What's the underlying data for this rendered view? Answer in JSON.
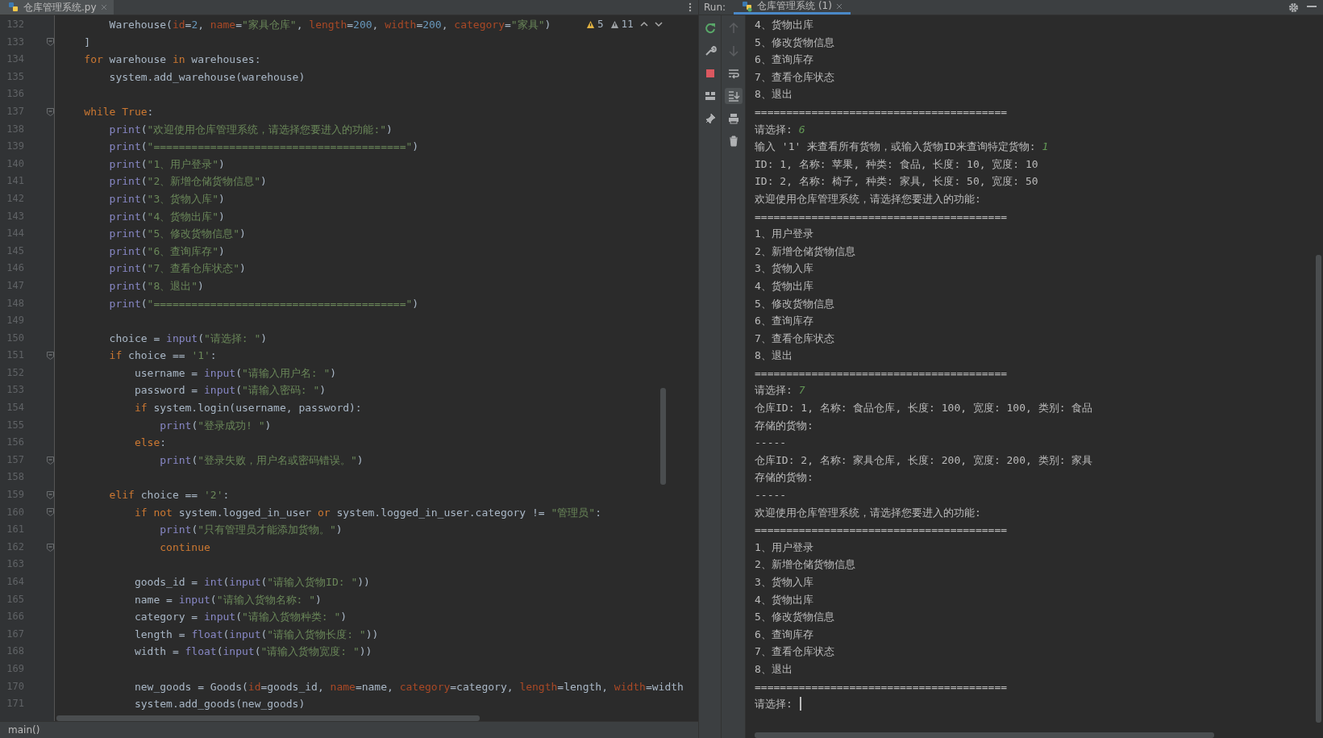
{
  "editor": {
    "tabs": [
      {
        "label": "仓库管理系统.py",
        "selected": true
      }
    ],
    "inspections": [
      {
        "kind": "warning",
        "count": "5"
      },
      {
        "kind": "weak-warning",
        "count": "11"
      }
    ],
    "lines": [
      {
        "number": "132",
        "fold": false,
        "tokens": [
          {
            "kind": "plain",
            "text": "        Warehouse("
          },
          {
            "kind": "param",
            "text": "id"
          },
          {
            "kind": "plain",
            "text": "="
          },
          {
            "kind": "num",
            "text": "2"
          },
          {
            "kind": "plain",
            "text": ", "
          },
          {
            "kind": "param",
            "text": "name"
          },
          {
            "kind": "plain",
            "text": "="
          },
          {
            "kind": "str",
            "text": "\"家具仓库\""
          },
          {
            "kind": "plain",
            "text": ", "
          },
          {
            "kind": "param",
            "text": "length"
          },
          {
            "kind": "plain",
            "text": "="
          },
          {
            "kind": "num",
            "text": "200"
          },
          {
            "kind": "plain",
            "text": ", "
          },
          {
            "kind": "param",
            "text": "width"
          },
          {
            "kind": "plain",
            "text": "="
          },
          {
            "kind": "num",
            "text": "200"
          },
          {
            "kind": "plain",
            "text": ", "
          },
          {
            "kind": "param",
            "text": "category"
          },
          {
            "kind": "plain",
            "text": "="
          },
          {
            "kind": "str",
            "text": "\"家具\""
          },
          {
            "kind": "plain",
            "text": ")"
          }
        ]
      },
      {
        "number": "133",
        "fold": true,
        "tokens": [
          {
            "kind": "plain",
            "text": "    ]"
          }
        ]
      },
      {
        "number": "134",
        "fold": false,
        "tokens": [
          {
            "kind": "kw",
            "text": "    for"
          },
          {
            "kind": "plain",
            "text": " warehouse "
          },
          {
            "kind": "kw",
            "text": "in"
          },
          {
            "kind": "plain",
            "text": " warehouses:"
          }
        ]
      },
      {
        "number": "135",
        "fold": false,
        "tokens": [
          {
            "kind": "plain",
            "text": "        system.add_warehouse(warehouse)"
          }
        ]
      },
      {
        "number": "136",
        "fold": false
      },
      {
        "number": "137",
        "fold": true,
        "tokens": [
          {
            "kind": "kw",
            "text": "    while"
          },
          {
            "kind": "kw",
            "text": " True"
          },
          {
            "kind": "plain",
            "text": ":"
          }
        ]
      },
      {
        "number": "138",
        "fold": false,
        "tokens": [
          {
            "kind": "fn",
            "text": "        print"
          },
          {
            "kind": "plain",
            "text": "("
          },
          {
            "kind": "str",
            "text": "\"欢迎使用仓库管理系统，请选择您要进入的功能:\""
          },
          {
            "kind": "plain",
            "text": ")"
          }
        ]
      },
      {
        "number": "139",
        "fold": false,
        "tokens": [
          {
            "kind": "fn",
            "text": "        print"
          },
          {
            "kind": "plain",
            "text": "("
          },
          {
            "kind": "str",
            "text": "\"========================================\""
          },
          {
            "kind": "plain",
            "text": ")"
          }
        ]
      },
      {
        "number": "140",
        "fold": false,
        "tokens": [
          {
            "kind": "fn",
            "text": "        print"
          },
          {
            "kind": "plain",
            "text": "("
          },
          {
            "kind": "str",
            "text": "\"1、用户登录\""
          },
          {
            "kind": "plain",
            "text": ")"
          }
        ]
      },
      {
        "number": "141",
        "fold": false,
        "tokens": [
          {
            "kind": "fn",
            "text": "        print"
          },
          {
            "kind": "plain",
            "text": "("
          },
          {
            "kind": "str",
            "text": "\"2、新增仓储货物信息\""
          },
          {
            "kind": "plain",
            "text": ")"
          }
        ]
      },
      {
        "number": "142",
        "fold": false,
        "tokens": [
          {
            "kind": "fn",
            "text": "        print"
          },
          {
            "kind": "plain",
            "text": "("
          },
          {
            "kind": "str",
            "text": "\"3、货物入库\""
          },
          {
            "kind": "plain",
            "text": ")"
          }
        ]
      },
      {
        "number": "143",
        "fold": false,
        "tokens": [
          {
            "kind": "fn",
            "text": "        print"
          },
          {
            "kind": "plain",
            "text": "("
          },
          {
            "kind": "str",
            "text": "\"4、货物出库\""
          },
          {
            "kind": "plain",
            "text": ")"
          }
        ]
      },
      {
        "number": "144",
        "fold": false,
        "tokens": [
          {
            "kind": "fn",
            "text": "        print"
          },
          {
            "kind": "plain",
            "text": "("
          },
          {
            "kind": "str",
            "text": "\"5、修改货物信息\""
          },
          {
            "kind": "plain",
            "text": ")"
          }
        ]
      },
      {
        "number": "145",
        "fold": false,
        "tokens": [
          {
            "kind": "fn",
            "text": "        print"
          },
          {
            "kind": "plain",
            "text": "("
          },
          {
            "kind": "str",
            "text": "\"6、查询库存\""
          },
          {
            "kind": "plain",
            "text": ")"
          }
        ]
      },
      {
        "number": "146",
        "fold": false,
        "tokens": [
          {
            "kind": "fn",
            "text": "        print"
          },
          {
            "kind": "plain",
            "text": "("
          },
          {
            "kind": "str",
            "text": "\"7、查看仓库状态\""
          },
          {
            "kind": "plain",
            "text": ")"
          }
        ]
      },
      {
        "number": "147",
        "fold": false,
        "tokens": [
          {
            "kind": "fn",
            "text": "        print"
          },
          {
            "kind": "plain",
            "text": "("
          },
          {
            "kind": "str",
            "text": "\"8、退出\""
          },
          {
            "kind": "plain",
            "text": ")"
          }
        ]
      },
      {
        "number": "148",
        "fold": false,
        "tokens": [
          {
            "kind": "fn",
            "text": "        print"
          },
          {
            "kind": "plain",
            "text": "("
          },
          {
            "kind": "str",
            "text": "\"========================================\""
          },
          {
            "kind": "plain",
            "text": ")"
          }
        ]
      },
      {
        "number": "149",
        "fold": false
      },
      {
        "number": "150",
        "fold": false,
        "tokens": [
          {
            "kind": "plain",
            "text": "        choice = "
          },
          {
            "kind": "fn",
            "text": "input"
          },
          {
            "kind": "plain",
            "text": "("
          },
          {
            "kind": "str",
            "text": "\"请选择: \""
          },
          {
            "kind": "plain",
            "text": ")"
          }
        ]
      },
      {
        "number": "151",
        "fold": true,
        "tokens": [
          {
            "kind": "kw",
            "text": "        if"
          },
          {
            "kind": "plain",
            "text": " choice == "
          },
          {
            "kind": "str",
            "text": "'1'"
          },
          {
            "kind": "plain",
            "text": ":"
          }
        ]
      },
      {
        "number": "152",
        "fold": false,
        "tokens": [
          {
            "kind": "plain",
            "text": "            username = "
          },
          {
            "kind": "fn",
            "text": "input"
          },
          {
            "kind": "plain",
            "text": "("
          },
          {
            "kind": "str",
            "text": "\"请输入用户名: \""
          },
          {
            "kind": "plain",
            "text": ")"
          }
        ]
      },
      {
        "number": "153",
        "fold": false,
        "tokens": [
          {
            "kind": "plain",
            "text": "            password = "
          },
          {
            "kind": "fn",
            "text": "input"
          },
          {
            "kind": "plain",
            "text": "("
          },
          {
            "kind": "str",
            "text": "\"请输入密码: \""
          },
          {
            "kind": "plain",
            "text": ")"
          }
        ]
      },
      {
        "number": "154",
        "fold": false,
        "tokens": [
          {
            "kind": "kw",
            "text": "            if"
          },
          {
            "kind": "plain",
            "text": " system.login(username, password):"
          }
        ]
      },
      {
        "number": "155",
        "fold": false,
        "tokens": [
          {
            "kind": "fn",
            "text": "                print"
          },
          {
            "kind": "plain",
            "text": "("
          },
          {
            "kind": "str",
            "text": "\"登录成功! \""
          },
          {
            "kind": "plain",
            "text": ")"
          }
        ]
      },
      {
        "number": "156",
        "fold": false,
        "tokens": [
          {
            "kind": "kw",
            "text": "            else"
          },
          {
            "kind": "plain",
            "text": ":"
          }
        ]
      },
      {
        "number": "157",
        "fold": true,
        "tokens": [
          {
            "kind": "fn",
            "text": "                print"
          },
          {
            "kind": "plain",
            "text": "("
          },
          {
            "kind": "str",
            "text": "\"登录失败，用户名或密码错误。\""
          },
          {
            "kind": "plain",
            "text": ")"
          }
        ]
      },
      {
        "number": "158",
        "fold": false
      },
      {
        "number": "159",
        "fold": true,
        "tokens": [
          {
            "kind": "kw",
            "text": "        elif"
          },
          {
            "kind": "plain",
            "text": " choice == "
          },
          {
            "kind": "str",
            "text": "'2'"
          },
          {
            "kind": "plain",
            "text": ":"
          }
        ]
      },
      {
        "number": "160",
        "fold": true,
        "tokens": [
          {
            "kind": "kw",
            "text": "            if"
          },
          {
            "kind": "kw",
            "text": " not"
          },
          {
            "kind": "plain",
            "text": " system.logged_in_user "
          },
          {
            "kind": "kw",
            "text": "or"
          },
          {
            "kind": "plain",
            "text": " system.logged_in_user.category != "
          },
          {
            "kind": "str",
            "text": "\"管理员\""
          },
          {
            "kind": "plain",
            "text": ":"
          }
        ]
      },
      {
        "number": "161",
        "fold": false,
        "tokens": [
          {
            "kind": "fn",
            "text": "                print"
          },
          {
            "kind": "plain",
            "text": "("
          },
          {
            "kind": "str",
            "text": "\"只有管理员才能添加货物。\""
          },
          {
            "kind": "plain",
            "text": ")"
          }
        ]
      },
      {
        "number": "162",
        "fold": true,
        "tokens": [
          {
            "kind": "kw",
            "text": "                continue"
          }
        ]
      },
      {
        "number": "163",
        "fold": false
      },
      {
        "number": "164",
        "fold": false,
        "tokens": [
          {
            "kind": "plain",
            "text": "            goods_id = "
          },
          {
            "kind": "fn",
            "text": "int"
          },
          {
            "kind": "plain",
            "text": "("
          },
          {
            "kind": "fn",
            "text": "input"
          },
          {
            "kind": "plain",
            "text": "("
          },
          {
            "kind": "str",
            "text": "\"请输入货物ID: \""
          },
          {
            "kind": "plain",
            "text": "))"
          }
        ]
      },
      {
        "number": "165",
        "fold": false,
        "tokens": [
          {
            "kind": "plain",
            "text": "            name = "
          },
          {
            "kind": "fn",
            "text": "input"
          },
          {
            "kind": "plain",
            "text": "("
          },
          {
            "kind": "str",
            "text": "\"请输入货物名称: \""
          },
          {
            "kind": "plain",
            "text": ")"
          }
        ]
      },
      {
        "number": "166",
        "fold": false,
        "tokens": [
          {
            "kind": "plain",
            "text": "            category = "
          },
          {
            "kind": "fn",
            "text": "input"
          },
          {
            "kind": "plain",
            "text": "("
          },
          {
            "kind": "str",
            "text": "\"请输入货物种类: \""
          },
          {
            "kind": "plain",
            "text": ")"
          }
        ]
      },
      {
        "number": "167",
        "fold": false,
        "tokens": [
          {
            "kind": "plain",
            "text": "            length = "
          },
          {
            "kind": "fn",
            "text": "float"
          },
          {
            "kind": "plain",
            "text": "("
          },
          {
            "kind": "fn",
            "text": "input"
          },
          {
            "kind": "plain",
            "text": "("
          },
          {
            "kind": "str",
            "text": "\"请输入货物长度: \""
          },
          {
            "kind": "plain",
            "text": "))"
          }
        ]
      },
      {
        "number": "168",
        "fold": false,
        "tokens": [
          {
            "kind": "plain",
            "text": "            width = "
          },
          {
            "kind": "fn",
            "text": "float"
          },
          {
            "kind": "plain",
            "text": "("
          },
          {
            "kind": "fn",
            "text": "input"
          },
          {
            "kind": "plain",
            "text": "("
          },
          {
            "kind": "str",
            "text": "\"请输入货物宽度: \""
          },
          {
            "kind": "plain",
            "text": "))"
          }
        ]
      },
      {
        "number": "169",
        "fold": false
      },
      {
        "number": "170",
        "fold": false,
        "tokens": [
          {
            "kind": "plain",
            "text": "            new_goods = Goods("
          },
          {
            "kind": "param",
            "text": "id"
          },
          {
            "kind": "plain",
            "text": "=goods_id, "
          },
          {
            "kind": "param",
            "text": "name"
          },
          {
            "kind": "plain",
            "text": "=name, "
          },
          {
            "kind": "param",
            "text": "category"
          },
          {
            "kind": "plain",
            "text": "=category, "
          },
          {
            "kind": "param",
            "text": "length"
          },
          {
            "kind": "plain",
            "text": "=length, "
          },
          {
            "kind": "param",
            "text": "width"
          },
          {
            "kind": "plain",
            "text": "=width"
          }
        ]
      },
      {
        "number": "171",
        "fold": false,
        "tokens": [
          {
            "kind": "plain",
            "text": "            system.add_goods(new_goods)"
          }
        ]
      }
    ],
    "breadcrumb": "main()"
  },
  "run": {
    "label": "Run:",
    "tabs": [
      {
        "label": "仓库管理系统 (1)",
        "selected": true
      }
    ],
    "actions": [
      {
        "kind": "rerun"
      },
      {
        "kind": "wrench"
      },
      {
        "kind": "stop"
      },
      {
        "kind": "layout"
      },
      {
        "kind": "pin"
      }
    ],
    "console_tools": [
      {
        "kind": "up",
        "disabled": true,
        "selected": false
      },
      {
        "kind": "down",
        "disabled": true,
        "selected": false
      },
      {
        "kind": "soft-wrap",
        "disabled": false,
        "selected": false
      },
      {
        "kind": "scroll-end",
        "disabled": false,
        "selected": true
      },
      {
        "kind": "print",
        "disabled": false,
        "selected": false
      },
      {
        "kind": "clear",
        "disabled": false,
        "selected": false
      }
    ],
    "console": {
      "cursor": true,
      "lines": [
        {
          "text": "4、货物出库"
        },
        {
          "text": "5、修改货物信息"
        },
        {
          "text": "6、查询库存"
        },
        {
          "text": "7、查看仓库状态"
        },
        {
          "text": "8、退出"
        },
        {
          "text": "========================================"
        },
        {
          "text": "请选择: ",
          "input": "6"
        },
        {
          "text": "输入 '1' 来查看所有货物，或输入货物ID来查询特定货物: ",
          "input": "1"
        },
        {
          "text": "ID: 1, 名称: 苹果, 种类: 食品, 长度: 10, 宽度: 10"
        },
        {
          "text": "ID: 2, 名称: 椅子, 种类: 家具, 长度: 50, 宽度: 50"
        },
        {
          "text": "欢迎使用仓库管理系统，请选择您要进入的功能:"
        },
        {
          "text": "========================================"
        },
        {
          "text": "1、用户登录"
        },
        {
          "text": "2、新增仓储货物信息"
        },
        {
          "text": "3、货物入库"
        },
        {
          "text": "4、货物出库"
        },
        {
          "text": "5、修改货物信息"
        },
        {
          "text": "6、查询库存"
        },
        {
          "text": "7、查看仓库状态"
        },
        {
          "text": "8、退出"
        },
        {
          "text": "========================================"
        },
        {
          "text": "请选择: ",
          "input": "7"
        },
        {
          "text": "仓库ID: 1, 名称: 食品仓库, 长度: 100, 宽度: 100, 类别: 食品"
        },
        {
          "text": "存储的货物:"
        },
        {
          "text": "-----"
        },
        {
          "text": "仓库ID: 2, 名称: 家具仓库, 长度: 200, 宽度: 200, 类别: 家具"
        },
        {
          "text": "存储的货物:"
        },
        {
          "text": "-----"
        },
        {
          "text": "欢迎使用仓库管理系统，请选择您要进入的功能:"
        },
        {
          "text": "========================================"
        },
        {
          "text": "1、用户登录"
        },
        {
          "text": "2、新增仓储货物信息"
        },
        {
          "text": "3、货物入库"
        },
        {
          "text": "4、货物出库"
        },
        {
          "text": "5、修改货物信息"
        },
        {
          "text": "6、查询库存"
        },
        {
          "text": "7、查看仓库状态"
        },
        {
          "text": "8、退出"
        },
        {
          "text": "========================================"
        },
        {
          "text": "请选择: "
        }
      ]
    }
  }
}
